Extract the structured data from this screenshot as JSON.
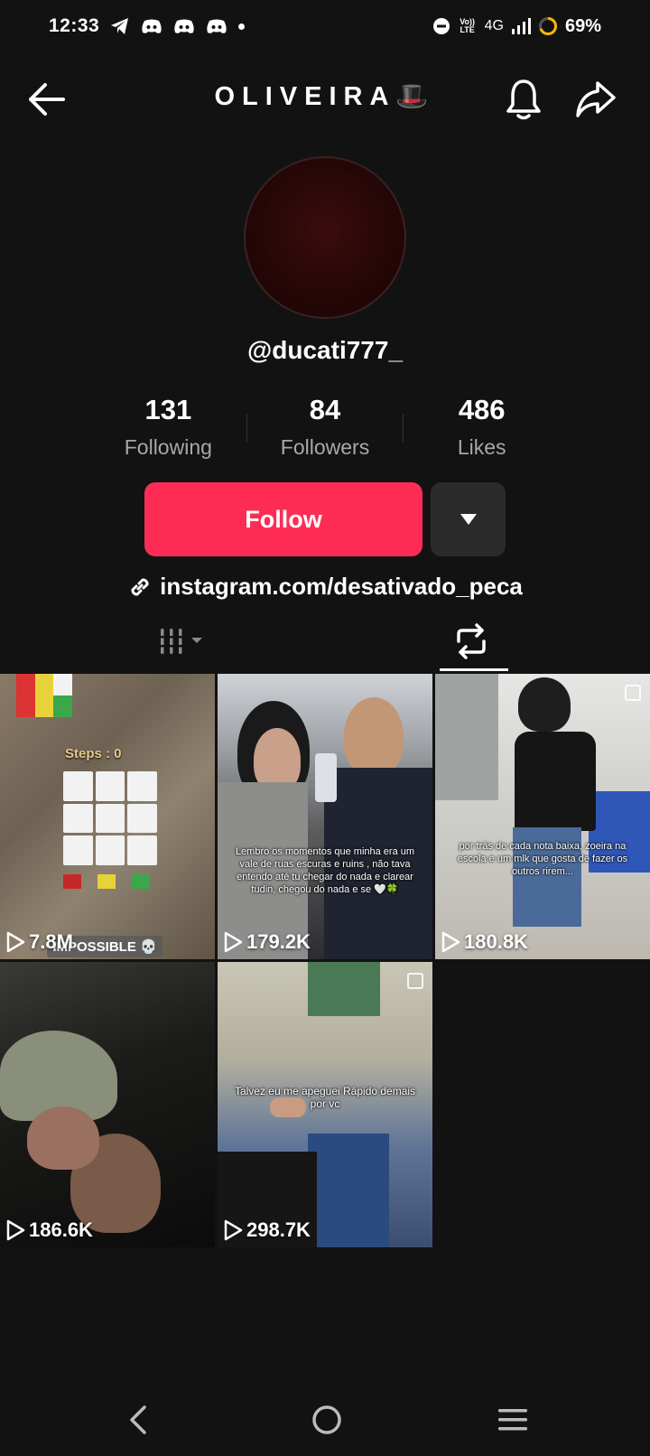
{
  "status_bar": {
    "time": "12:33",
    "network": "4G",
    "volte": "Vo)) LTE",
    "battery": "69%"
  },
  "header": {
    "title": "OLIVEIRA🎩"
  },
  "profile": {
    "username": "@ducati777_",
    "stats": [
      {
        "value": "131",
        "label": "Following"
      },
      {
        "value": "84",
        "label": "Followers"
      },
      {
        "value": "486",
        "label": "Likes"
      }
    ],
    "follow_label": "Follow",
    "link": "instagram.com/desativado_peca"
  },
  "videos": [
    {
      "views": "7.8M",
      "overlay": "IMPOSSIBLE 💀",
      "steps": "Steps : 0"
    },
    {
      "views": "179.2K",
      "caption": "Lembro os momentos que minha era um vale de ruas escuras e ruins , não tava entendo até tu chegar do nada e clarear tudin, chegou do nada e se 🤍🍀"
    },
    {
      "views": "180.8K",
      "caption": "por trás de cada nota baixa, zoeira na escola e um mlk que gosta de fazer os outros rirem..."
    },
    {
      "views": "186.6K"
    },
    {
      "views": "298.7K",
      "caption": "Talvez eu me apeguei Rápido demais por vc"
    }
  ],
  "colors": {
    "background": "#121212",
    "follow": "#fe2c55",
    "secondary_button": "#2b2b2b",
    "muted_text": "#a8a8a8"
  }
}
